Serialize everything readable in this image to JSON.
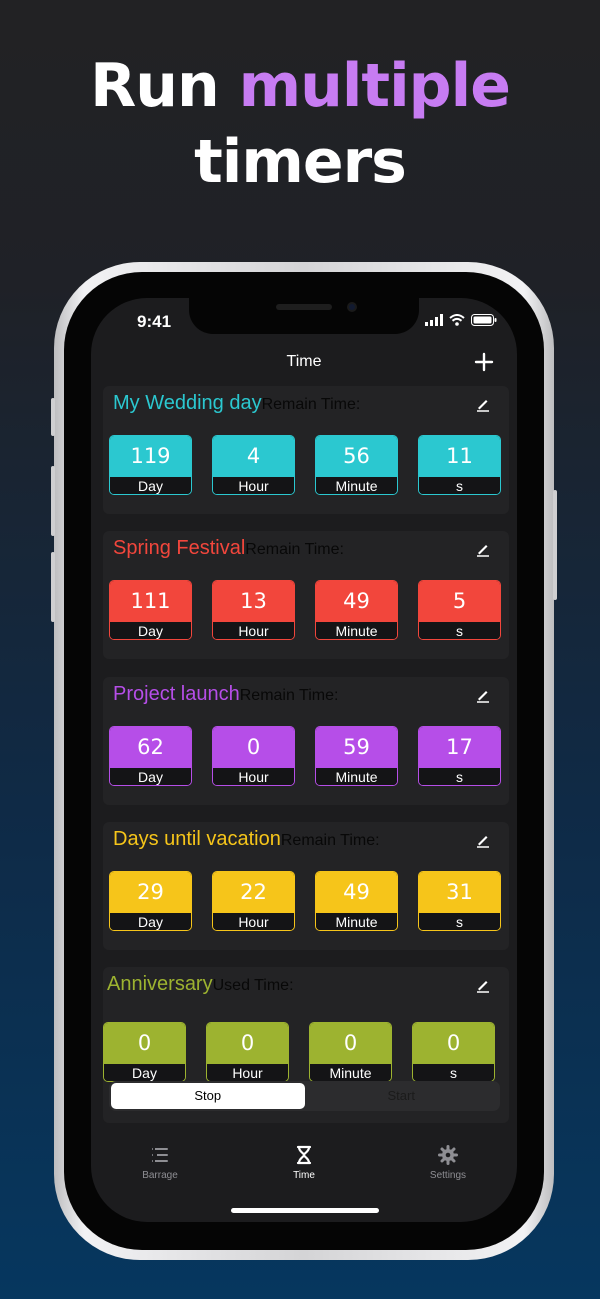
{
  "headline": {
    "line1_a": "Run ",
    "line1_b": "multiple",
    "line2": "timers"
  },
  "status": {
    "time": "9:41"
  },
  "nav": {
    "title": "Time"
  },
  "cards": [
    {
      "name": "My Wedding day",
      "sub": "Remain Time:",
      "color": "#2bc8d0",
      "values": [
        "119",
        "4",
        "56",
        "11"
      ],
      "units": [
        "Day",
        "Hour",
        "Minute",
        "s"
      ]
    },
    {
      "name": "Spring Festival",
      "sub": "Remain Time:",
      "color": "#f2463c",
      "values": [
        "111",
        "13",
        "49",
        "5"
      ],
      "units": [
        "Day",
        "Hour",
        "Minute",
        "s"
      ]
    },
    {
      "name": "Project launch",
      "sub": "Remain Time:",
      "color": "#b64ee8",
      "values": [
        "62",
        "0",
        "59",
        "17"
      ],
      "units": [
        "Day",
        "Hour",
        "Minute",
        "s"
      ]
    },
    {
      "name": "Days until vacation",
      "sub": "Remain Time:",
      "color": "#f6c51a",
      "values": [
        "29",
        "22",
        "49",
        "31"
      ],
      "units": [
        "Day",
        "Hour",
        "Minute",
        "s"
      ]
    },
    {
      "name": "Anniversary",
      "sub": "Used Time:",
      "color": "#9db330",
      "values": [
        "0",
        "0",
        "0",
        "0"
      ],
      "units": [
        "Day",
        "Hour",
        "Minute",
        "s"
      ]
    }
  ],
  "segment": {
    "stop": "Stop",
    "start": "Start"
  },
  "tabs": [
    {
      "label": "Barrage",
      "icon": "list-icon"
    },
    {
      "label": "Time",
      "icon": "hourglass-icon"
    },
    {
      "label": "Settings",
      "icon": "gear-icon"
    }
  ]
}
